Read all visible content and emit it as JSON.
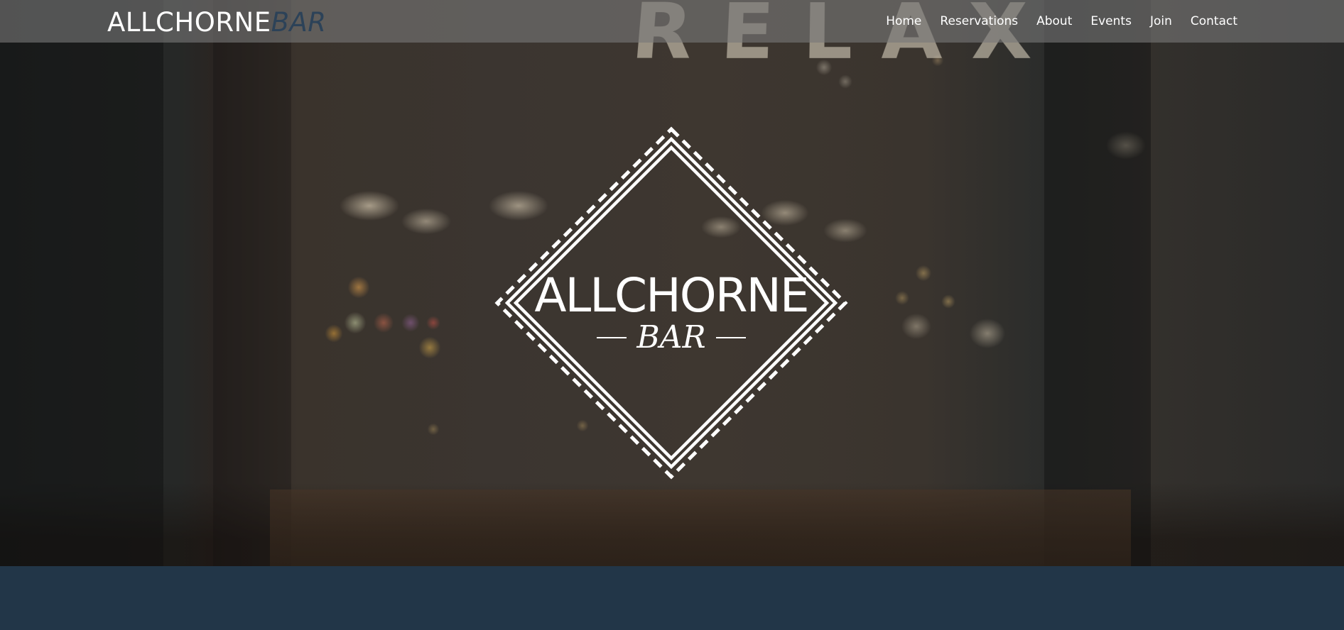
{
  "brand": {
    "primary": "ALLCHORNE",
    "secondary": "BAR",
    "secondary_color": "#2c4258"
  },
  "nav": {
    "items": [
      {
        "label": "Home"
      },
      {
        "label": "Reservations"
      },
      {
        "label": "About"
      },
      {
        "label": "Events"
      },
      {
        "label": "Join"
      },
      {
        "label": "Contact"
      }
    ]
  },
  "hero": {
    "background_text": "RELAX",
    "logo": {
      "main": "ALLCHORNE",
      "sub": "BAR"
    }
  },
  "colors": {
    "footer_band": "#223648",
    "navbar": "rgba(120,120,120,0.62)",
    "text": "#ffffff"
  }
}
